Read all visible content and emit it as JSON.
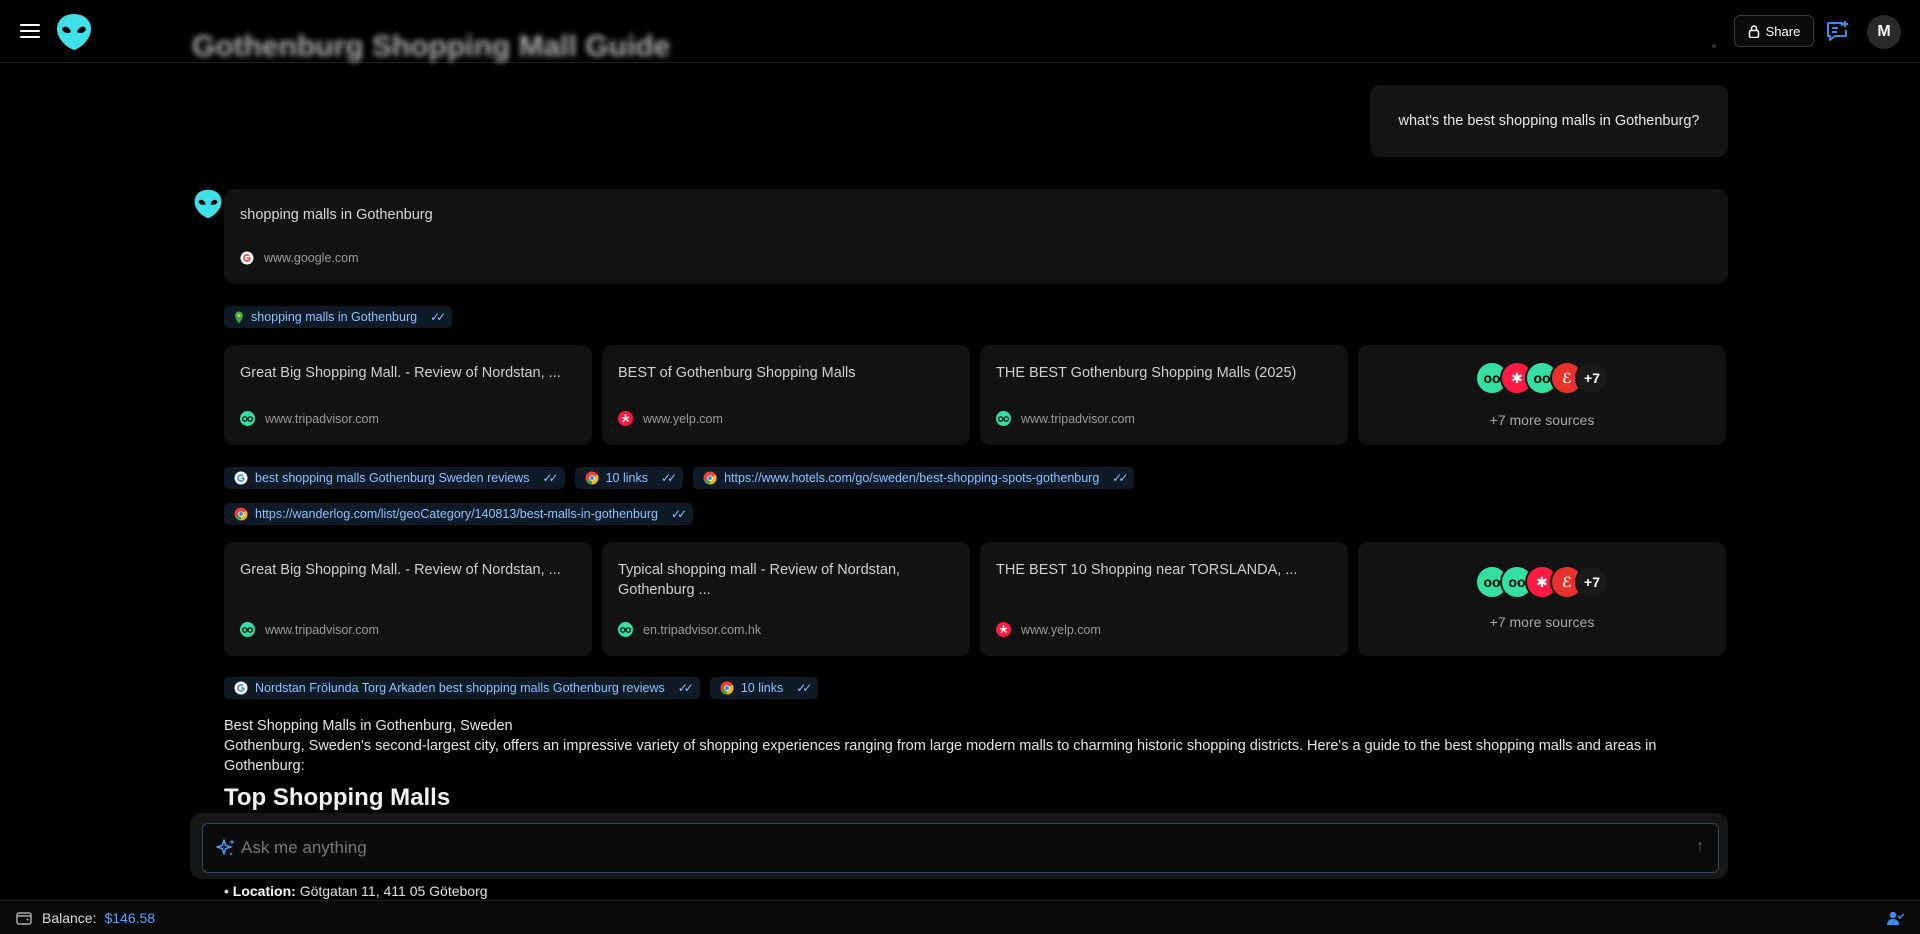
{
  "header": {
    "title": "Gothenburg Shopping Mall Guide",
    "share_label": "Share",
    "avatar_initial": "M"
  },
  "user_message": "what's the best shopping malls in Gothenburg?",
  "first_search": {
    "query": "shopping malls in Gothenburg",
    "source": "www.google.com"
  },
  "pills_row1": [
    {
      "label": "shopping malls in Gothenburg",
      "icon": "map-pin-icon"
    }
  ],
  "cards_row1": [
    {
      "title": "Great Big Shopping Mall. - Review of Nordstan, ...",
      "source": "www.tripadvisor.com",
      "icon": "tripadvisor-icon"
    },
    {
      "title": "BEST of Gothenburg Shopping Malls",
      "source": "www.yelp.com",
      "icon": "yelp-icon"
    },
    {
      "title": "THE BEST Gothenburg Shopping Malls (2025)",
      "source": "www.tripadvisor.com",
      "icon": "tripadvisor-icon"
    }
  ],
  "more_row1": {
    "count": "+7",
    "label": "+7 more sources"
  },
  "pills_row2": [
    {
      "label": "best shopping malls Gothenburg Sweden reviews",
      "icon": "google-icon"
    },
    {
      "label": "10 links",
      "icon": "chrome-icon"
    },
    {
      "label": "https://www.hotels.com/go/sweden/best-shopping-spots-gothenburg",
      "icon": "chrome-icon"
    }
  ],
  "pills_row3": [
    {
      "label": "https://wanderlog.com/list/geoCategory/140813/best-malls-in-gothenburg",
      "icon": "chrome-icon"
    }
  ],
  "cards_row2": [
    {
      "title": "Great Big Shopping Mall. - Review of Nordstan, ...",
      "source": "www.tripadvisor.com",
      "icon": "tripadvisor-icon"
    },
    {
      "title": "Typical shopping mall - Review of Nordstan, Gothenburg ...",
      "source": "en.tripadvisor.com.hk",
      "icon": "tripadvisor-icon"
    },
    {
      "title": "THE BEST 10 Shopping near TORSLANDA, ...",
      "source": "www.yelp.com",
      "icon": "yelp-icon"
    }
  ],
  "more_row2": {
    "count": "+7",
    "label": "+7 more sources"
  },
  "pills_row4": [
    {
      "label": "Nordstan Frölunda Torg Arkaden best shopping malls Gothenburg reviews",
      "icon": "google-icon"
    },
    {
      "label": "10 links",
      "icon": "chrome-icon"
    }
  ],
  "answer": {
    "heading_line": "Best Shopping Malls in Gothenburg, Sweden",
    "intro": "Gothenburg, Sweden's second-largest city, offers an impressive variety of shopping experiences ranging from large modern malls to charming historic shopping districts. Here's a guide to the best shopping malls and areas in Gothenburg:",
    "section_title": "Top Shopping Malls",
    "location_label": "Location:",
    "location_value": "Götgatan 11, 411 05 Göteborg"
  },
  "input": {
    "placeholder": "Ask me anything"
  },
  "footer": {
    "balance_label": "Balance:",
    "balance_value": "$146.58"
  },
  "colors": {
    "accent": "#5aa2ff",
    "pill_text": "#8ec1ff",
    "alien": "#3fe0e8",
    "tripadvisor": "#34e0a1",
    "yelp": "#ff1a44"
  }
}
